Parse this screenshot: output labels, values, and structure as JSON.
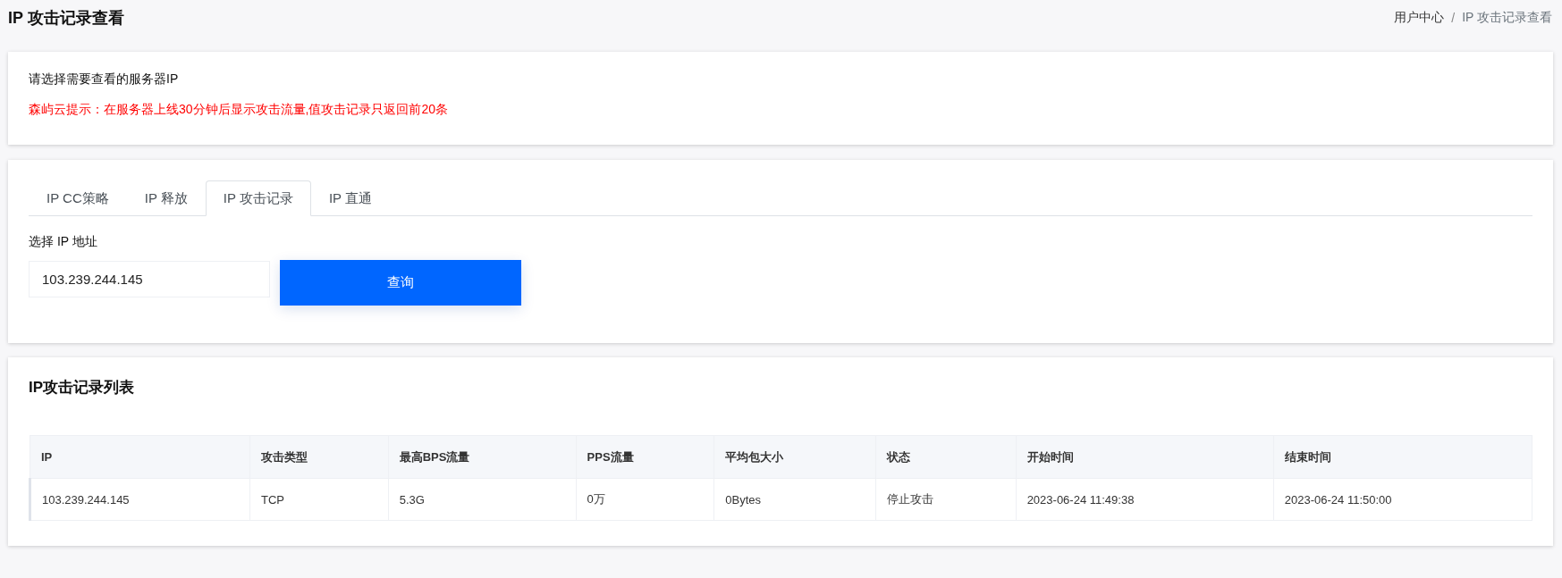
{
  "page_title": "IP 攻击记录查看",
  "breadcrumb": [
    {
      "label": "用户中心",
      "selected": false
    },
    {
      "label": "IP 攻击记录查看",
      "selected": true
    }
  ],
  "breadcrumb_separator": "/",
  "notice": {
    "prompt": "请选择需要查看的服务器IP",
    "warning": "森屿云提示：在服务器上线30分钟后显示攻击流量,值攻击记录只返回前20条"
  },
  "tabs": [
    {
      "label": "IP CC策略",
      "selected": false
    },
    {
      "label": "IP 释放",
      "selected": false
    },
    {
      "label": "IP 攻击记录",
      "selected": true
    },
    {
      "label": "IP 直通",
      "selected": false
    }
  ],
  "ip_field": {
    "label": "选择 IP 地址",
    "value": "103.239.244.145"
  },
  "query_button": "查询",
  "table": {
    "title": "IP攻击记录列表",
    "columns": [
      "IP",
      "攻击类型",
      "最高BPS流量",
      "PPS流量",
      "平均包大小",
      "状态",
      "开始时间",
      "结束时间"
    ],
    "rows": [
      [
        "103.239.244.145",
        "TCP",
        "5.3G",
        "0万",
        "0Bytes",
        "停止攻击",
        "2023-06-24 11:49:38",
        "2023-06-24 11:50:00"
      ]
    ]
  }
}
